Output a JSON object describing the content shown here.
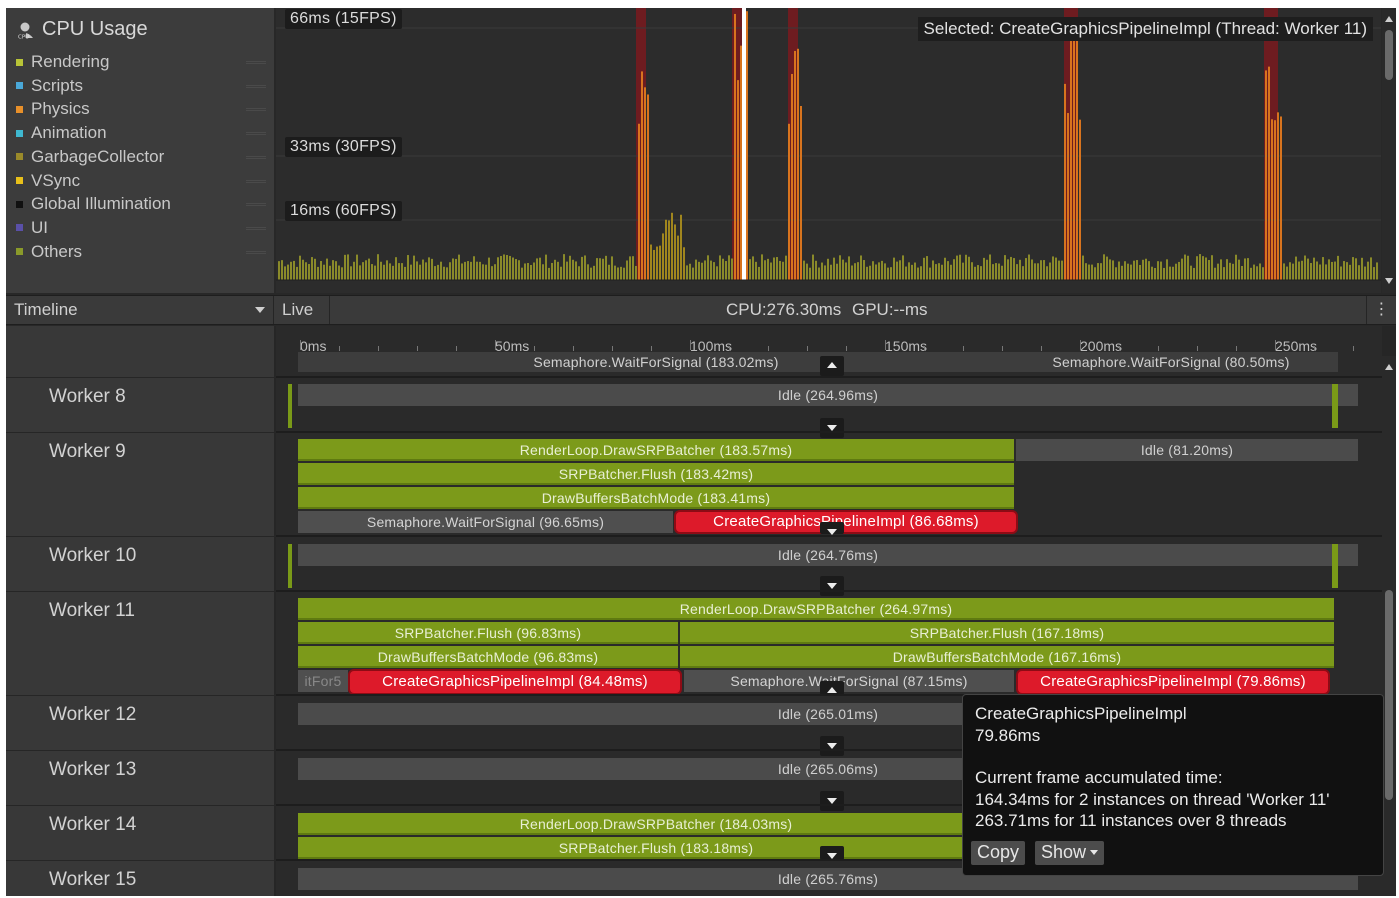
{
  "legend": {
    "title": "CPU Usage",
    "items": [
      {
        "label": "Rendering",
        "color": "#b8c437"
      },
      {
        "label": "Scripts",
        "color": "#4aa8d8"
      },
      {
        "label": "Physics",
        "color": "#e8902a"
      },
      {
        "label": "Animation",
        "color": "#3fb8d0"
      },
      {
        "label": "GarbageCollector",
        "color": "#9a8a2a"
      },
      {
        "label": "VSync",
        "color": "#e8c01a"
      },
      {
        "label": "Global Illumination",
        "color": "#101010"
      },
      {
        "label": "UI",
        "color": "#5a50a8"
      },
      {
        "label": "Others",
        "color": "#8a9a2a"
      }
    ]
  },
  "graph": {
    "fps_labels": {
      "fps15": "66ms (15FPS)",
      "fps30": "33ms (30FPS)",
      "fps60": "16ms (60FPS)"
    },
    "selected": "Selected: CreateGraphicsPipelineImpl (Thread: Worker 11)"
  },
  "toolbar": {
    "view": "Timeline",
    "live": "Live",
    "cpu_gpu": "CPU:276.30ms GPU:--ms",
    "more_icon": "kebab-menu-icon"
  },
  "timeline": {
    "ruler": [
      "0ms",
      "50ms",
      "100ms",
      "150ms",
      "200ms",
      "250ms"
    ],
    "main_thread": {
      "bar_left": "Semaphore.WaitForSignal (183.02ms)",
      "bar_right": "Semaphore.WaitForSignal (80.50ms)"
    },
    "workers": {
      "w8": {
        "name": "Worker 8",
        "idle": "Idle (264.96ms)"
      },
      "w9": {
        "name": "Worker 9",
        "render_loop": "RenderLoop.DrawSRPBatcher (183.57ms)",
        "idle": "Idle (81.20ms)",
        "flush": "SRPBatcher.Flush (183.42ms)",
        "draw_buffers": "DrawBuffersBatchMode (183.41ms)",
        "wait": "Semaphore.WaitForSignal (96.65ms)",
        "create": "CreateGraphicsPipelineImpl (86.68ms)"
      },
      "w10": {
        "name": "Worker 10",
        "idle": "Idle (264.76ms)"
      },
      "w11": {
        "name": "Worker 11",
        "render_loop": "RenderLoop.DrawSRPBatcher (264.97ms)",
        "flush_left": "SRPBatcher.Flush (96.83ms)",
        "flush_right": "SRPBatcher.Flush (167.18ms)",
        "draw_left": "DrawBuffersBatchMode (96.83ms)",
        "draw_right": "DrawBuffersBatchMode (167.16ms)",
        "wait_stub": "itFor5",
        "create_left": "CreateGraphicsPipelineImpl (84.48ms)",
        "wait": "Semaphore.WaitForSignal (87.15ms)",
        "create_right": "CreateGraphicsPipelineImpl (79.86ms)"
      },
      "w12": {
        "name": "Worker 12",
        "idle": "Idle (265.01ms)"
      },
      "w13": {
        "name": "Worker 13",
        "idle": "Idle (265.06ms)"
      },
      "w14": {
        "name": "Worker 14",
        "render_loop": "RenderLoop.DrawSRPBatcher (184.03ms)",
        "flush": "SRPBatcher.Flush (183.18ms)"
      },
      "w15": {
        "name": "Worker 15",
        "idle": "Idle (265.76ms)"
      }
    }
  },
  "tooltip": {
    "name": "CreateGraphicsPipelineImpl",
    "time": "79.86ms",
    "accum_title": "Current frame accumulated time:",
    "accum_thread": "164.34ms for 2 instances on thread 'Worker 11'",
    "accum_all": "263.71ms for 11 instances over 8 threads",
    "copy": "Copy",
    "show": "Show"
  }
}
